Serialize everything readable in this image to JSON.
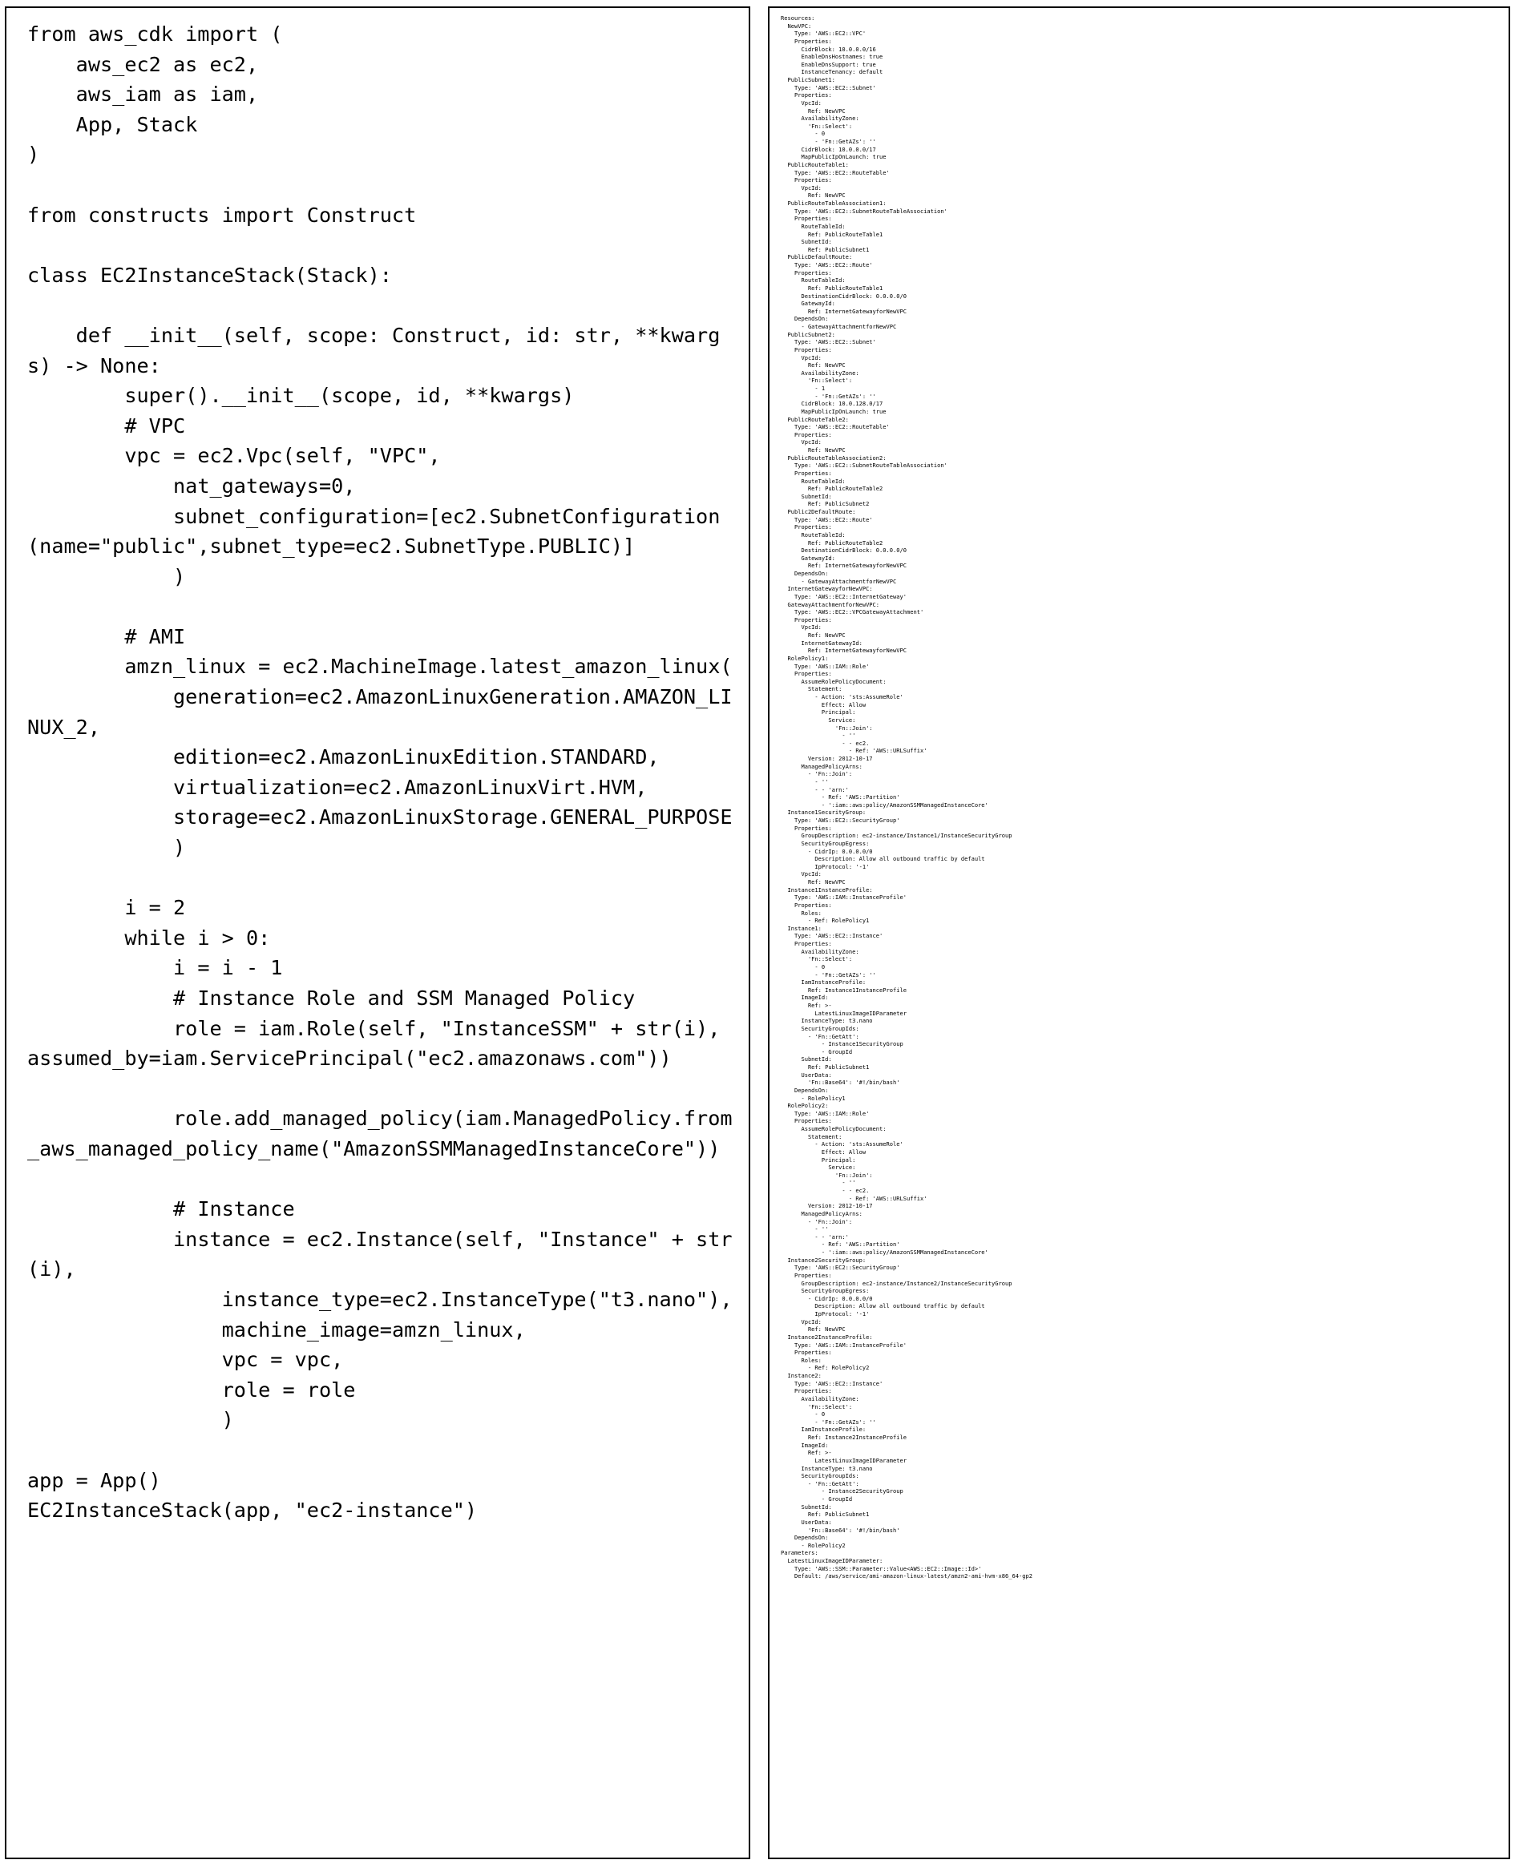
{
  "layout": {
    "type": "two-panel-code-comparison",
    "left_panel_name": "cdk-python-source",
    "right_panel_name": "cloudformation-yaml-output",
    "background_color": "#ffffff",
    "text_color": "#000000",
    "border_color": "#000000"
  },
  "left_panel": {
    "language": "python",
    "code": "from aws_cdk import (\n    aws_ec2 as ec2,\n    aws_iam as iam,\n    App, Stack\n)\n\nfrom constructs import Construct\n\nclass EC2InstanceStack(Stack):\n\n    def __init__(self, scope: Construct, id: str, **kwargs) -> None:\n        super().__init__(scope, id, **kwargs)\n        # VPC\n        vpc = ec2.Vpc(self, \"VPC\",\n            nat_gateways=0,\n            subnet_configuration=[ec2.SubnetConfiguration(name=\"public\",subnet_type=ec2.SubnetType.PUBLIC)]\n            )\n\n        # AMI\n        amzn_linux = ec2.MachineImage.latest_amazon_linux(\n            generation=ec2.AmazonLinuxGeneration.AMAZON_LINUX_2,\n            edition=ec2.AmazonLinuxEdition.STANDARD,\n            virtualization=ec2.AmazonLinuxVirt.HVM,\n            storage=ec2.AmazonLinuxStorage.GENERAL_PURPOSE\n            )\n\n        i = 2\n        while i > 0:\n            i = i - 1\n            # Instance Role and SSM Managed Policy\n            role = iam.Role(self, \"InstanceSSM\" + str(i), assumed_by=iam.ServicePrincipal(\"ec2.amazonaws.com\"))\n\n            role.add_managed_policy(iam.ManagedPolicy.from_aws_managed_policy_name(\"AmazonSSMManagedInstanceCore\"))\n\n            # Instance\n            instance = ec2.Instance(self, \"Instance\" + str(i),\n                instance_type=ec2.InstanceType(\"t3.nano\"),\n                machine_image=amzn_linux,\n                vpc = vpc,\n                role = role\n                )\n\napp = App()\nEC2InstanceStack(app, \"ec2-instance\")"
  },
  "right_panel": {
    "language": "yaml",
    "code": "Resources:\n  NewVPC:\n    Type: 'AWS::EC2::VPC'\n    Properties:\n      CidrBlock: 10.0.0.0/16\n      EnableDnsHostnames: true\n      EnableDnsSupport: true\n      InstanceTenancy: default\n  PublicSubnet1:\n    Type: 'AWS::EC2::Subnet'\n    Properties:\n      VpcId:\n        Ref: NewVPC\n      AvailabilityZone:\n        'Fn::Select':\n          - 0\n          - 'Fn::GetAZs': ''\n      CidrBlock: 10.0.0.0/17\n      MapPublicIpOnLaunch: true\n  PublicRouteTable1:\n    Type: 'AWS::EC2::RouteTable'\n    Properties:\n      VpcId:\n        Ref: NewVPC\n  PublicRouteTableAssociation1:\n    Type: 'AWS::EC2::SubnetRouteTableAssociation'\n    Properties:\n      RouteTableId:\n        Ref: PublicRouteTable1\n      SubnetId:\n        Ref: PublicSubnet1\n  PublicDefaultRoute:\n    Type: 'AWS::EC2::Route'\n    Properties:\n      RouteTableId:\n        Ref: PublicRouteTable1\n      DestinationCidrBlock: 0.0.0.0/0\n      GatewayId:\n        Ref: InternetGatewayforNewVPC\n    DependsOn:\n      - GatewayAttachmentforNewVPC\n  PublicSubnet2:\n    Type: 'AWS::EC2::Subnet'\n    Properties:\n      VpcId:\n        Ref: NewVPC\n      AvailabilityZone:\n        'Fn::Select':\n          - 1\n          - 'Fn::GetAZs': ''\n      CidrBlock: 10.0.128.0/17\n      MapPublicIpOnLaunch: true\n  PublicRouteTable2:\n    Type: 'AWS::EC2::RouteTable'\n    Properties:\n      VpcId:\n        Ref: NewVPC\n  PublicRouteTableAssociation2:\n    Type: 'AWS::EC2::SubnetRouteTableAssociation'\n    Properties:\n      RouteTableId:\n        Ref: PublicRouteTable2\n      SubnetId:\n        Ref: PublicSubnet2\n  Public2DefaultRoute:\n    Type: 'AWS::EC2::Route'\n    Properties:\n      RouteTableId:\n        Ref: PublicRouteTable2\n      DestinationCidrBlock: 0.0.0.0/0\n      GatewayId:\n        Ref: InternetGatewayforNewVPC\n    DependsOn:\n      - GatewayAttachmentforNewVPC\n  InternetGatewayforNewVPC:\n    Type: 'AWS::EC2::InternetGateway'\n  GatewayAttachmentforNewVPC:\n    Type: 'AWS::EC2::VPCGatewayAttachment'\n    Properties:\n      VpcId:\n        Ref: NewVPC\n      InternetGatewayId:\n        Ref: InternetGatewayforNewVPC\n  RolePolicy1:\n    Type: 'AWS::IAM::Role'\n    Properties:\n      AssumeRolePolicyDocument:\n        Statement:\n          - Action: 'sts:AssumeRole'\n            Effect: Allow\n            Principal:\n              Service:\n                'Fn::Join':\n                  - ''\n                  - - ec2.\n                    - Ref: 'AWS::URLSuffix'\n        Version: 2012-10-17\n      ManagedPolicyArns:\n        - 'Fn::Join':\n          - ''\n          - - 'arn:'\n            - Ref: 'AWS::Partition'\n            - ':iam::aws:policy/AmazonSSMManagedInstanceCore'\n  Instance1SecurityGroup:\n    Type: 'AWS::EC2::SecurityGroup'\n    Properties:\n      GroupDescription: ec2-instance/Instance1/InstanceSecurityGroup\n      SecurityGroupEgress:\n        - CidrIp: 0.0.0.0/0\n          Description: Allow all outbound traffic by default\n          IpProtocol: '-1'\n      VpcId:\n        Ref: NewVPC\n  Instance1InstanceProfile:\n    Type: 'AWS::IAM::InstanceProfile'\n    Properties:\n      Roles:\n        - Ref: RolePolicy1\n  Instance1:\n    Type: 'AWS::EC2::Instance'\n    Properties:\n      AvailabilityZone:\n        'Fn::Select':\n          - 0\n          - 'Fn::GetAZs': ''\n      IamInstanceProfile:\n        Ref: Instance1InstanceProfile\n      ImageId:\n        Ref: >-\n          LatestLinuxImageIDParameter\n      InstanceType: t3.nano\n      SecurityGroupIds:\n        - 'Fn::GetAtt':\n            - Instance1SecurityGroup\n            - GroupId\n      SubnetId:\n        Ref: PublicSubnet1\n      UserData:\n        'Fn::Base64': '#!/bin/bash'\n    DependsOn:\n      - RolePolicy1\n  RolePolicy2:\n    Type: 'AWS::IAM::Role'\n    Properties:\n      AssumeRolePolicyDocument:\n        Statement:\n          - Action: 'sts:AssumeRole'\n            Effect: Allow\n            Principal:\n              Service:\n                'Fn::Join':\n                  - ''\n                  - - ec2.\n                    - Ref: 'AWS::URLSuffix'\n        Version: 2012-10-17\n      ManagedPolicyArns:\n        - 'Fn::Join':\n          - ''\n          - - 'arn:'\n            - Ref: 'AWS::Partition'\n            - ':iam::aws:policy/AmazonSSMManagedInstanceCore'\n  Instance2SecurityGroup:\n    Type: 'AWS::EC2::SecurityGroup'\n    Properties:\n      GroupDescription: ec2-instance/Instance2/InstanceSecurityGroup\n      SecurityGroupEgress:\n        - CidrIp: 0.0.0.0/0\n          Description: Allow all outbound traffic by default\n          IpProtocol: '-1'\n      VpcId:\n        Ref: NewVPC\n  Instance2InstanceProfile:\n    Type: 'AWS::IAM::InstanceProfile'\n    Properties:\n      Roles:\n        - Ref: RolePolicy2\n  Instance2:\n    Type: 'AWS::EC2::Instance'\n    Properties:\n      AvailabilityZone:\n        'Fn::Select':\n          - 0\n          - 'Fn::GetAZs': ''\n      IamInstanceProfile:\n        Ref: Instance2InstanceProfile\n      ImageId:\n        Ref: >-\n          LatestLinuxImageIDParameter\n      InstanceType: t3.nano\n      SecurityGroupIds:\n        - 'Fn::GetAtt':\n            - Instance2SecurityGroup\n            - GroupId\n      SubnetId:\n        Ref: PublicSubnet1\n      UserData:\n        'Fn::Base64': '#!/bin/bash'\n    DependsOn:\n      - RolePolicy2\nParameters:\n  LatestLinuxImageIDParameter:\n    Type: 'AWS::SSM::Parameter::Value<AWS::EC2::Image::Id>'\n    Default: /aws/service/ami-amazon-linux-latest/amzn2-ami-hvm-x86_64-gp2"
  }
}
